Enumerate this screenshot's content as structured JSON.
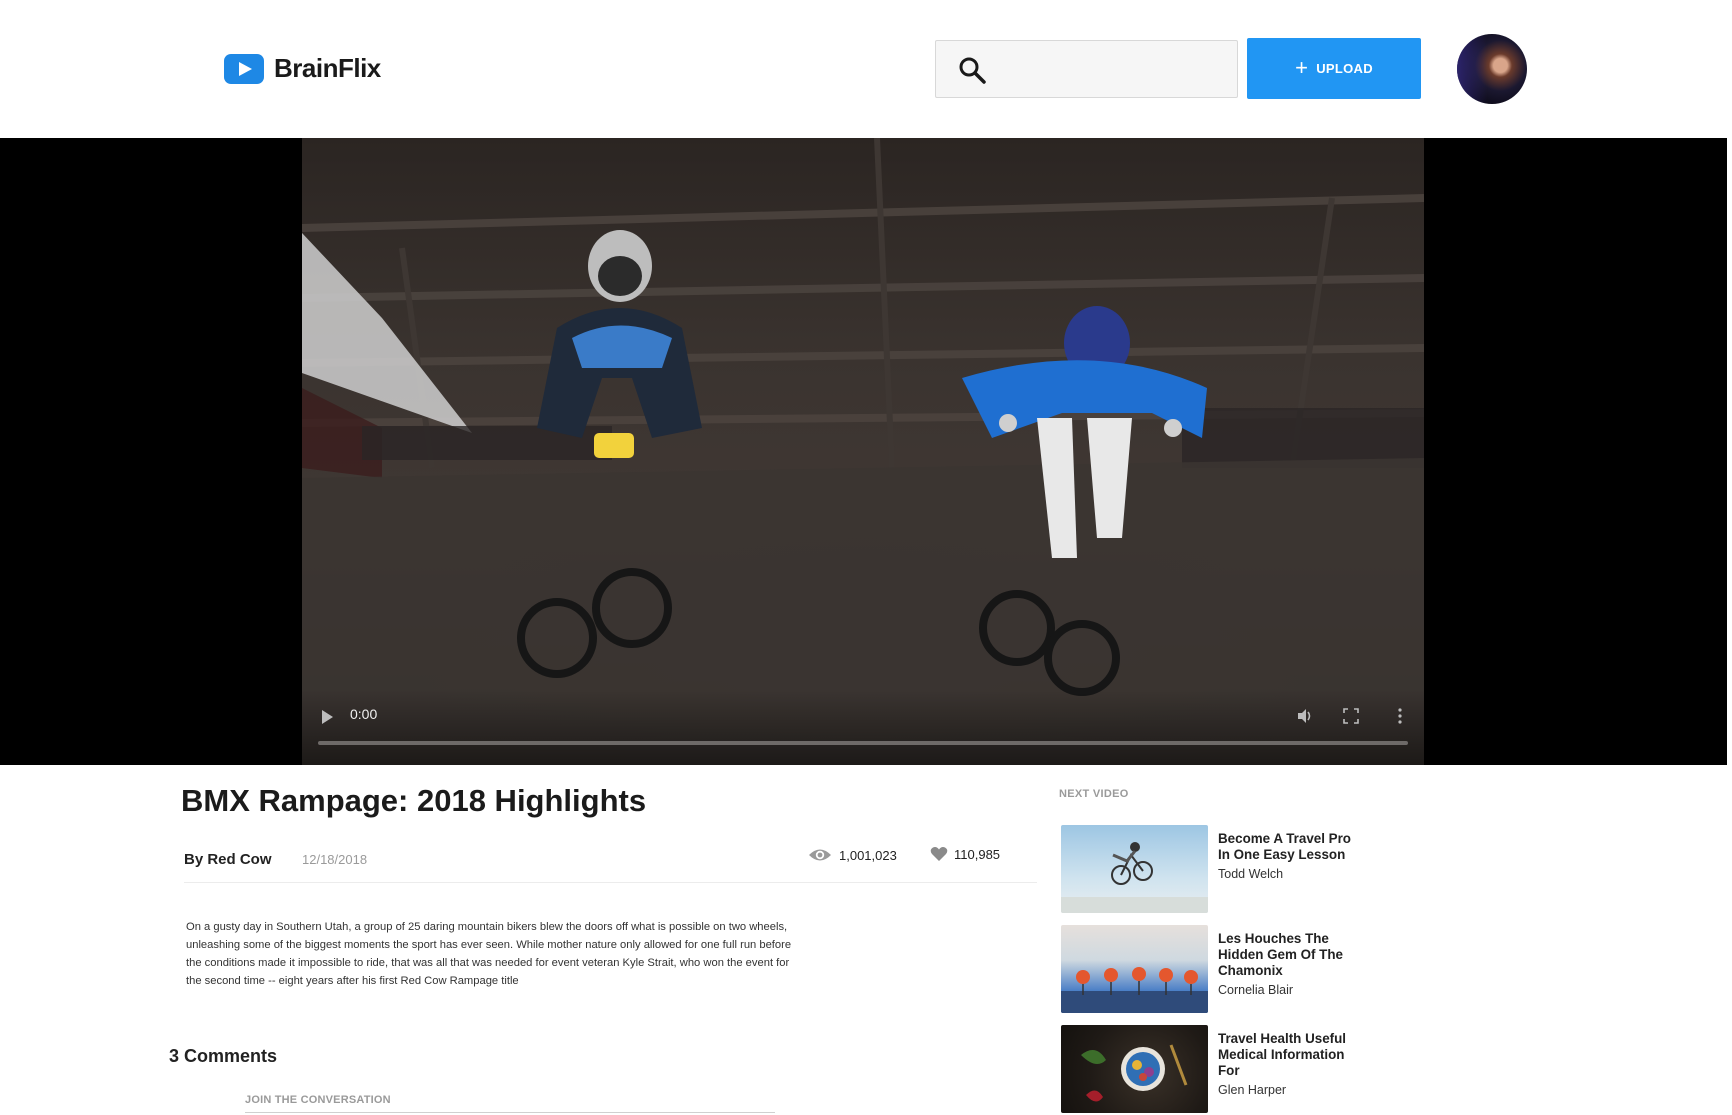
{
  "header": {
    "logo_text": "BrainFlix",
    "search": {
      "value": "",
      "placeholder": ""
    },
    "upload_label": "UPLOAD",
    "upload_icon": "plus-icon",
    "avatar_icon": "user-avatar"
  },
  "video": {
    "time": "0:00",
    "progress": 0
  },
  "main": {
    "title": "BMX Rampage: 2018 Highlights",
    "author": "By Red Cow",
    "date": "12/18/2018",
    "views": "1,001,023",
    "likes": "110,985",
    "description": "On a gusty day in Southern Utah, a group of 25 daring mountain bikers blew the doors off what is possible on two wheels, unleashing some of the biggest moments the sport has ever seen. While mother nature only allowed for one full run before the conditions made it impossible to ride, that was all that was needed for event veteran Kyle Strait, who won the event for the second time -- eight years after his first Red Cow Rampage title",
    "comments_title": "3 Comments",
    "join_label": "JOIN THE CONVERSATION"
  },
  "sidebar": {
    "heading": "NEXT VIDEO",
    "videos": [
      {
        "title": "Become A Travel Pro In One Easy Lesson",
        "author": "Todd Welch"
      },
      {
        "title": "Les Houches The Hidden Gem Of The Chamonix",
        "author": "Cornelia Blair"
      },
      {
        "title": "Travel Health Useful Medical Information For",
        "author": "Glen Harper"
      }
    ]
  },
  "colors": {
    "accent": "#2196f3",
    "text": "#222222",
    "muted": "#9a9a9a"
  }
}
